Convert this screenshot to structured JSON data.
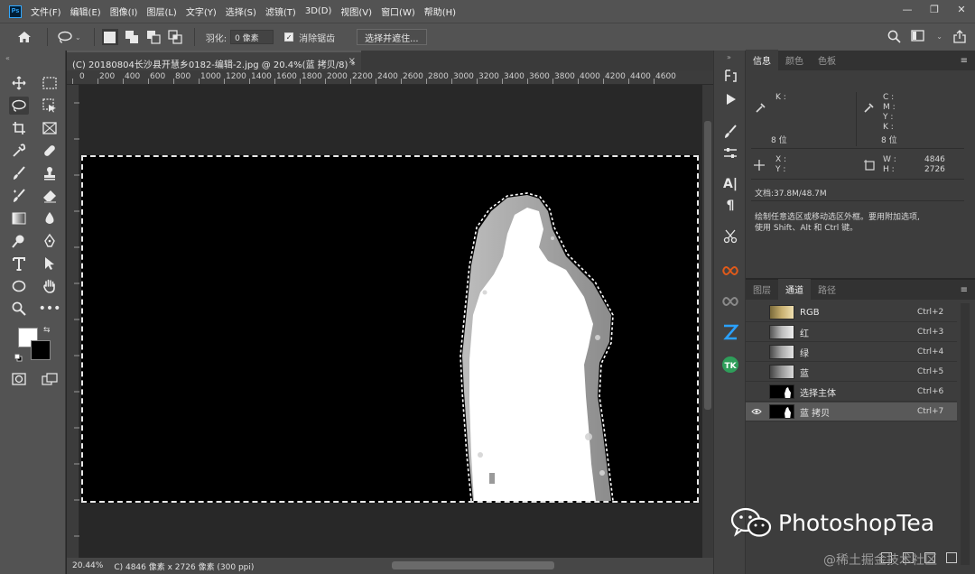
{
  "menubar": {
    "items": [
      "文件(F)",
      "编辑(E)",
      "图像(I)",
      "图层(L)",
      "文字(Y)",
      "选择(S)",
      "滤镜(T)",
      "3D(D)",
      "视图(V)",
      "窗口(W)",
      "帮助(H)"
    ],
    "logo": "Ps"
  },
  "window_controls": {
    "minimize": "—",
    "restore": "❐",
    "close": "✕"
  },
  "options": {
    "feather_label": "羽化:",
    "feather_value": "0 像素",
    "antialias_label": "消除锯齿",
    "select_mask_label": "选择并遮住..."
  },
  "document": {
    "tab_title": "(C) 20180804长沙县开慧乡0182-编辑-2.jpg @ 20.4%(蓝 拷贝/8) *",
    "close": "×"
  },
  "ruler": {
    "ticks": [
      "0",
      "200",
      "400",
      "600",
      "800",
      "1000",
      "1200",
      "1400",
      "1600",
      "1800",
      "2000",
      "2200",
      "2400",
      "2600",
      "2800",
      "3000",
      "3200",
      "3400",
      "3600",
      "3800",
      "4000",
      "4200",
      "4400",
      "4600"
    ]
  },
  "status": {
    "zoom": "20.44%",
    "info": "C) 4846 像素 x 2726 像素 (300 ppi)"
  },
  "info_panel": {
    "tabs": [
      "信息",
      "颜色",
      "色板"
    ],
    "k_label": "K :",
    "bits_left": "8 位",
    "cmyk_labels": [
      "C :",
      "M :",
      "Y :",
      "K :"
    ],
    "bits_right": "8 位",
    "x_label": "X :",
    "y_label": "Y :",
    "w_label": "W :",
    "h_label": "H :",
    "width_value": "4846",
    "height_value": "2726",
    "doc_size": "文档:37.8M/48.7M",
    "hint_line1": "绘制任意选区或移动选区外框。要用附加选项,",
    "hint_line2": "使用 Shift、Alt 和 Ctrl 键。"
  },
  "channels_panel": {
    "tabs": [
      "图层",
      "通道",
      "路径"
    ],
    "rows": [
      {
        "name": "RGB",
        "shortcut": "Ctrl+2"
      },
      {
        "name": "红",
        "shortcut": "Ctrl+3"
      },
      {
        "name": "绿",
        "shortcut": "Ctrl+4"
      },
      {
        "name": "蓝",
        "shortcut": "Ctrl+5"
      },
      {
        "name": "选择主体",
        "shortcut": "Ctrl+6"
      },
      {
        "name": "蓝 拷贝",
        "shortcut": "Ctrl+7"
      }
    ]
  },
  "watermark": {
    "brand": "PhotoshopTea",
    "sub": "@稀土掘金技术社区"
  }
}
